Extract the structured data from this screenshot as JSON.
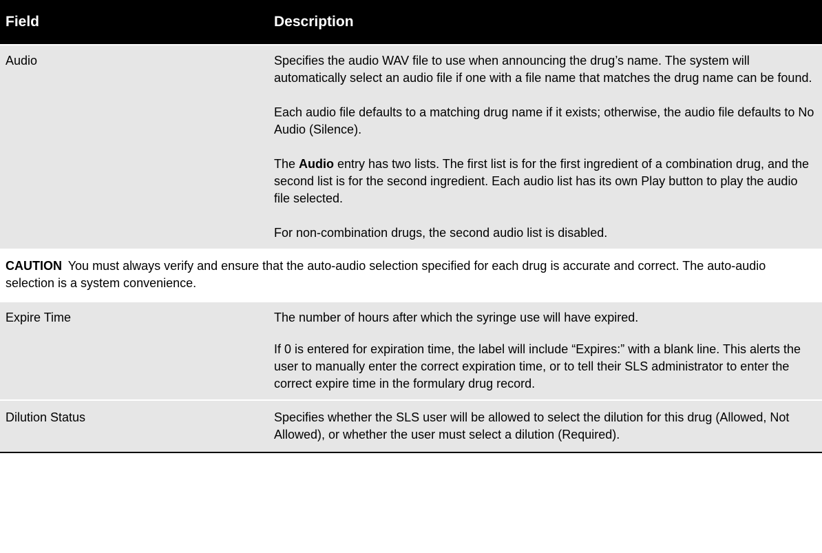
{
  "table": {
    "headers": {
      "field": "Field",
      "description": "Description"
    },
    "rows": [
      {
        "field": "Audio",
        "paragraphs": [
          "Specifies the audio WAV file to use when announcing the drug’s name. The system will automatically select an audio file if one with a file name that matches the drug name can be found.",
          "Each audio file defaults to a matching drug name if it exists; otherwise, the audio file defaults to No Audio (Silence).",
          {
            "before": "The ",
            "bold": "Audio",
            "after": " entry has two lists. The first list is for the first ingredient of a combination drug, and the second list is for the second ingredient. Each audio list has its own Play button to play the audio file selected."
          },
          "For non-combination drugs, the second audio list is disabled."
        ]
      },
      {
        "field": "Expire Time",
        "paragraphs": [
          "The number of hours after which the syringe use will have expired.",
          "If 0 is entered for expiration time, the label will include “Expires:” with a blank line. This alerts the user to manually enter the correct expiration time, or to tell their SLS administrator to enter the correct expire time in the formulary drug record."
        ]
      },
      {
        "field": "Dilution Status",
        "paragraphs": [
          "Specifies whether the SLS user will be allowed to select the dilution for this drug (Allowed, Not Allowed), or whether the user must select a dilution (Required)."
        ]
      }
    ]
  },
  "caution": {
    "label": "CAUTION",
    "text": "You must always verify and ensure that the auto-audio selection specified for each drug is accurate and correct. The auto-audio selection is a system convenience."
  }
}
